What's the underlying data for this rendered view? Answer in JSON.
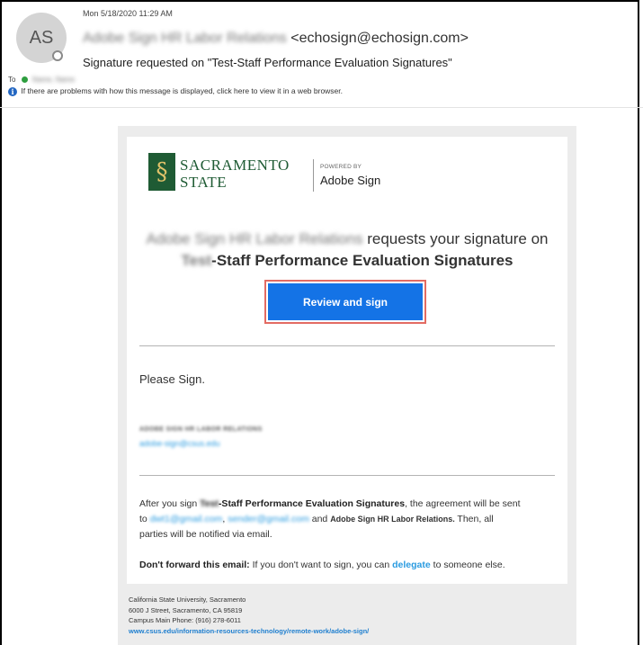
{
  "header": {
    "avatar_initials": "AS",
    "date": "Mon 5/18/2020 11:29 AM",
    "sender_name": "Adobe Sign HR Labor Relations",
    "sender_email": "<echosign@echosign.com>",
    "subject": "Signature requested on \"Test-Staff Performance Evaluation Signatures\"",
    "to_label": "To",
    "to_recipient": "Name, Name",
    "info_text": "If there are problems with how this message is displayed, click here to view it in a web browser."
  },
  "body": {
    "logo_line1": "SACRAMENTO",
    "logo_line2": "STATE",
    "powered_by": "POWERED BY",
    "adobe_sign": "Adobe Sign",
    "requester": "Adobe Sign HR Labor Relations",
    "request_text": "requests your signature on",
    "doc_prefix": "Test",
    "doc_rest": "-Staff Performance Evaluation Signatures",
    "review_button": "Review and sign",
    "please_sign": "Please Sign.",
    "signer_name": "ADOBE SIGN HR LABOR RELATIONS",
    "signer_email": "adobe-sign@csus.edu",
    "after_1": "After you sign ",
    "after_doc_prefix": "Test",
    "after_doc_rest": "-Staff Performance Evaluation Signatures",
    "after_2": ", the agreement will be sent",
    "after_3": "to ",
    "recipient1": "dwt1@gmail.com",
    "recipient2": "sender@gmail.com",
    "after_and": " and ",
    "after_party": "Adobe Sign HR Labor Relations.",
    "after_4": " Then, all",
    "after_5": "parties will be notified via email.",
    "forward_bold": "Don't forward this email:",
    "forward_text": " If you don't want to sign, you can ",
    "delegate": "delegate",
    "forward_end": " to someone else."
  },
  "footer": {
    "line1": "California State University, Sacramento",
    "line2": "6000 J Street, Sacramento, CA 95819",
    "line3": "Campus Main Phone: (916) 278-6011",
    "link": "www.csus.edu/information-resources-technology/remote-work/adobe-sign/"
  },
  "colors": {
    "button": "#1473e6",
    "button_outline": "#e36b63",
    "link": "#2a9be0",
    "brand_green": "#1f5b34"
  }
}
